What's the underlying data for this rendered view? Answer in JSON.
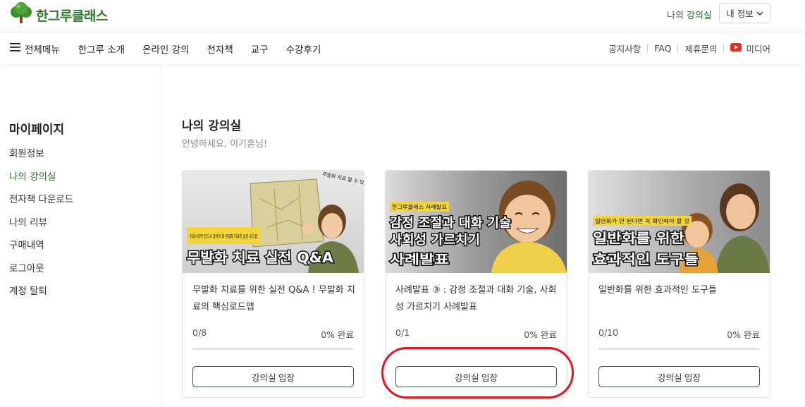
{
  "header": {
    "logo_text": "한그루클래스",
    "my_class_link": "나의 강의실",
    "my_info_label": "내 정보"
  },
  "nav": {
    "all_menu_label": "전체메뉴",
    "items": [
      {
        "label": "한그루 소개"
      },
      {
        "label": "온라인 강의"
      },
      {
        "label": "전자책"
      },
      {
        "label": "교구"
      },
      {
        "label": "수강후기"
      }
    ],
    "right_links": [
      {
        "label": "공지사항"
      },
      {
        "label": "FAQ"
      },
      {
        "label": "제휴문의"
      }
    ],
    "media_label": "미디어",
    "media_icon": "youtube-icon",
    "media_color": "#e52d27"
  },
  "sidebar": {
    "title": "마이페이지",
    "items": [
      {
        "label": "회원정보"
      },
      {
        "label": "나의 강의실"
      },
      {
        "label": "전자책 다운로드"
      },
      {
        "label": "나의 리뷰"
      },
      {
        "label": "구매내역"
      },
      {
        "label": "로그아웃"
      },
      {
        "label": "계정 탈퇴"
      }
    ],
    "active_index": 1
  },
  "main": {
    "title": "나의 강의실",
    "greeting": "안녕하세요, 이기훈님!"
  },
  "courses": [
    {
      "thumb_tag": "치료사라면 반드시 알아야 할 무발화 치료의 실전 로드맵",
      "thumb_headline": "무발화 치료 실전 Q&A",
      "thumb_bubble": "무발화 치료 할 수 있어!",
      "title": "무발화 치료를 위한 실전 Q&A ! 무발화 치료의 핵심로드맵",
      "progress_count": "0/8",
      "progress_pct": "0% 완료",
      "progress": 0,
      "button_label": "강의실 입장"
    },
    {
      "thumb_tag": "한그루클래스 사례발표",
      "thumb_headline_line1": "감정 조절과 대화 기술",
      "thumb_headline_line2": "사회성 가르치기",
      "thumb_headline_line3": "사례발표",
      "title": "사례발표 ③ : 감정 조절과 대화 기술, 사회성 가르치기 사례발표",
      "progress_count": "0/1",
      "progress_pct": "0% 완료",
      "progress": 0,
      "button_label": "강의실 입장"
    },
    {
      "thumb_tag": "일반화가 안 된다면 꼭 확인해야 할 것",
      "thumb_headline_line1": "일반화를 위한",
      "thumb_headline_line2": "효과적인 도구들",
      "title": "일반화를 위한 효과적인 도구들",
      "progress_count": "0/10",
      "progress_pct": "0% 완료",
      "progress": 0,
      "button_label": "강의실 입장"
    }
  ],
  "colors": {
    "brand_green": "#2e6b35",
    "highlight_red": "#e2151b"
  }
}
